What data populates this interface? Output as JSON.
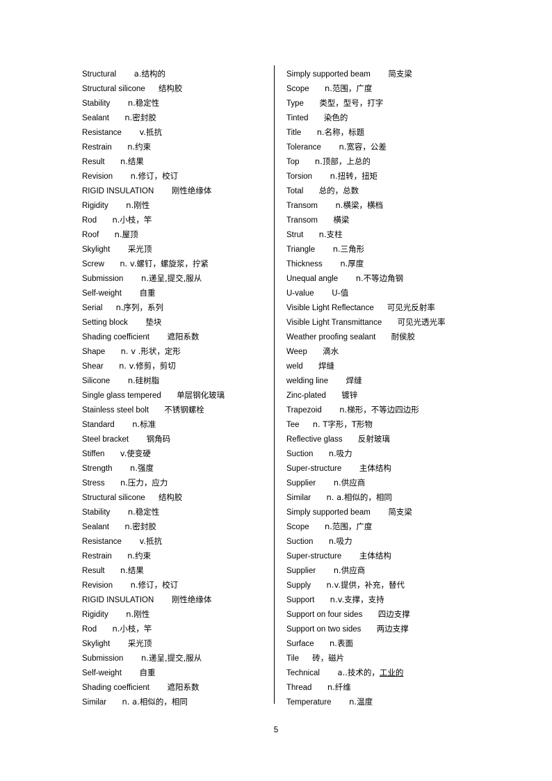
{
  "document": {
    "type": "bilingual-glossary",
    "page_number": "5",
    "divider": true
  },
  "left_column": [
    {
      "term": "Structural",
      "gap": "        ",
      "def": "a.结构的"
    },
    {
      "term": "Structural silicone",
      "gap": "      ",
      "def": "结构胶"
    },
    {
      "term": "Stability",
      "gap": "        ",
      "def": "n.稳定性"
    },
    {
      "term": "Sealant",
      "gap": "       ",
      "def": "n.密封胶"
    },
    {
      "term": "Resistance",
      "gap": "        ",
      "def": "v.抵抗"
    },
    {
      "term": "Restrain",
      "gap": "       ",
      "def": "n.约束"
    },
    {
      "term": "Result",
      "gap": "       ",
      "def": "n.结果"
    },
    {
      "term": "Revision",
      "gap": "        ",
      "def": "n.修订，校订"
    },
    {
      "term": "RIGID INSULATION",
      "gap": "        ",
      "def": "刚性绝缘体"
    },
    {
      "term": "Rigidity",
      "gap": "        ",
      "def": "n.刚性"
    },
    {
      "term": "Rod",
      "gap": "       ",
      "def": "n.小枝，竿"
    },
    {
      "term": "Roof",
      "gap": "       ",
      "def": "n.屋顶"
    },
    {
      "term": "Skylight",
      "gap": "        ",
      "def": "采光顶"
    },
    {
      "term": "Screw",
      "gap": "       ",
      "def": "n. v.螺钉，螺旋浆，拧紧"
    },
    {
      "term": "Submission",
      "gap": "        ",
      "def": "n.递呈,提交,服从"
    },
    {
      "term": "Self-weight",
      "gap": "        ",
      "def": "自重"
    },
    {
      "term": "Serial",
      "gap": "      ",
      "def": "n.序列，系列"
    },
    {
      "term": "Setting block",
      "gap": "        ",
      "def": "垫块"
    },
    {
      "term": "Shading coefficient",
      "gap": "        ",
      "def": "遮阳系数"
    },
    {
      "term": "Shape",
      "gap": "       ",
      "def": "n. v .形状，定形"
    },
    {
      "term": "Shear",
      "gap": "       ",
      "def": "n. v.修剪，剪切"
    },
    {
      "term": "Silicone",
      "gap": "        ",
      "def": "n.硅树脂"
    },
    {
      "term": "Single glass tempered",
      "gap": "       ",
      "def": "单层钢化玻璃"
    },
    {
      "term": "Stainless steel bolt",
      "gap": "       ",
      "def": "不锈钢螺栓"
    },
    {
      "term": "Standard",
      "gap": "        ",
      "def": "n.标准"
    },
    {
      "term": "Steel bracket",
      "gap": "        ",
      "def": "钢角码"
    },
    {
      "term": "Stiffen",
      "gap": "       ",
      "def": "v.使变硬"
    },
    {
      "term": "Strength",
      "gap": "        ",
      "def": "n.强度"
    },
    {
      "term": "Stress",
      "gap": "       ",
      "def": "n.压力，应力"
    },
    {
      "term": "Structural silicone",
      "gap": "      ",
      "def": "结构胶"
    },
    {
      "term": "Stability",
      "gap": "        ",
      "def": "n.稳定性"
    },
    {
      "term": "Sealant",
      "gap": "       ",
      "def": "n.密封胶"
    },
    {
      "term": "Resistance",
      "gap": "        ",
      "def": "v.抵抗"
    },
    {
      "term": "Restrain",
      "gap": "       ",
      "def": "n.约束"
    },
    {
      "term": "Result",
      "gap": "       ",
      "def": "n.结果"
    },
    {
      "term": "Revision",
      "gap": "        ",
      "def": "n.修订，校订"
    },
    {
      "term": "RIGID INSULATION",
      "gap": "        ",
      "def": "刚性绝缘体"
    },
    {
      "term": "Rigidity",
      "gap": "        ",
      "def": "n.刚性"
    },
    {
      "term": "Rod",
      "gap": "       ",
      "def": "n.小枝，竿"
    },
    {
      "term": "Skylight",
      "gap": "        ",
      "def": "采光顶"
    },
    {
      "term": "Submission",
      "gap": "        ",
      "def": "n.递呈,提交,服从"
    },
    {
      "term": "Self-weight",
      "gap": "        ",
      "def": "自重"
    },
    {
      "term": "Shading coefficient",
      "gap": "        ",
      "def": "遮阳系数"
    },
    {
      "term": "Similar",
      "gap": "       ",
      "def": "n. a.相似的，相同"
    }
  ],
  "right_column": [
    {
      "term": "Simply supported beam",
      "gap": "        ",
      "def": "简支梁"
    },
    {
      "term": "Scope",
      "gap": "       ",
      "def": "n.范围，广度"
    },
    {
      "term": "Type",
      "gap": "       ",
      "def": "类型，型号，打字"
    },
    {
      "term": "Tinted",
      "gap": "       ",
      "def": "染色的"
    },
    {
      "term": "Title",
      "gap": "       ",
      "def": "n.名称，标题"
    },
    {
      "term": "Tolerance",
      "gap": "        ",
      "def": "n.宽容，公差"
    },
    {
      "term": "Top",
      "gap": "       ",
      "def": "n.顶部，上总的"
    },
    {
      "term": "Torsion",
      "gap": "        ",
      "def": "n.扭转，扭矩"
    },
    {
      "term": "Total",
      "gap": "       ",
      "def": "总的，总数"
    },
    {
      "term": "Transom",
      "gap": "        ",
      "def": "n.横梁，横档"
    },
    {
      "term": "Transom",
      "gap": "       ",
      "def": "横梁"
    },
    {
      "term": "Strut",
      "gap": "       ",
      "def": "n.支柱"
    },
    {
      "term": "Triangle",
      "gap": "        ",
      "def": "n.三角形"
    },
    {
      "term": "Thickness",
      "gap": "        ",
      "def": "n.厚度"
    },
    {
      "term": "Unequal angle",
      "gap": "        ",
      "def": "n.不等边角钢"
    },
    {
      "term": "U-value",
      "gap": "        ",
      "def": "U-值"
    },
    {
      "term": "Visible Light Reflectance",
      "gap": "      ",
      "def": "可见光反射率"
    },
    {
      "term": "Visible Light Transmittance",
      "gap": "       ",
      "def": "可见光透光率"
    },
    {
      "term": "Weather proofing sealant",
      "gap": "       ",
      "def": "耐侯胶"
    },
    {
      "term": "Weep",
      "gap": "       ",
      "def": "滴水"
    },
    {
      "term": "weld",
      "gap": "       ",
      "def": "焊缝"
    },
    {
      "term": "welding line",
      "gap": "        ",
      "def": "焊缝"
    },
    {
      "term": "Zinc-plated",
      "gap": "       ",
      "def": "镀锌"
    },
    {
      "term": "Trapezoid",
      "gap": "        ",
      "def": "n.梯形，不等边四边形"
    },
    {
      "term": "Tee",
      "gap": "      ",
      "def": "n. T字形，T形物"
    },
    {
      "term": "Reflective glass",
      "gap": "       ",
      "def": "反射玻璃"
    },
    {
      "term": "Suction",
      "gap": "       ",
      "def": "n.吸力"
    },
    {
      "term": "Super-structure",
      "gap": "        ",
      "def": "主体结构"
    },
    {
      "term": "Supplier",
      "gap": "        ",
      "def": "n.供应商"
    },
    {
      "term": "Similar",
      "gap": "       ",
      "def": "n. a.相似的，相同"
    },
    {
      "term": "Simply supported beam",
      "gap": "        ",
      "def": "简支梁"
    },
    {
      "term": "Scope",
      "gap": "       ",
      "def": "n.范围，广度"
    },
    {
      "term": "Suction",
      "gap": "       ",
      "def": "n.吸力"
    },
    {
      "term": "Super-structure",
      "gap": "        ",
      "def": "主体结构"
    },
    {
      "term": "Supplier",
      "gap": "        ",
      "def": "n.供应商"
    },
    {
      "term": "Supply",
      "gap": "       ",
      "def": "n.v.提供，补充，替代"
    },
    {
      "term": "Support",
      "gap": "       ",
      "def": "n.v.支撑，支持"
    },
    {
      "term": "Support on four sides",
      "gap": "       ",
      "def": "四边支撑"
    },
    {
      "term": "Support on two sides",
      "gap": "       ",
      "def": "两边支撑"
    },
    {
      "term": "Surface",
      "gap": "       ",
      "def": "n.表面"
    },
    {
      "term": "Tile",
      "gap": "      ",
      "def": "砖，磁片"
    },
    {
      "term": "Technical",
      "gap": "        ",
      "def": "a..技术的，",
      "def_underlined": "工业的"
    },
    {
      "term": "Thread",
      "gap": "       ",
      "def": "n.纤维"
    },
    {
      "term": "Temperature",
      "gap": "        ",
      "def": "n.温度"
    }
  ]
}
